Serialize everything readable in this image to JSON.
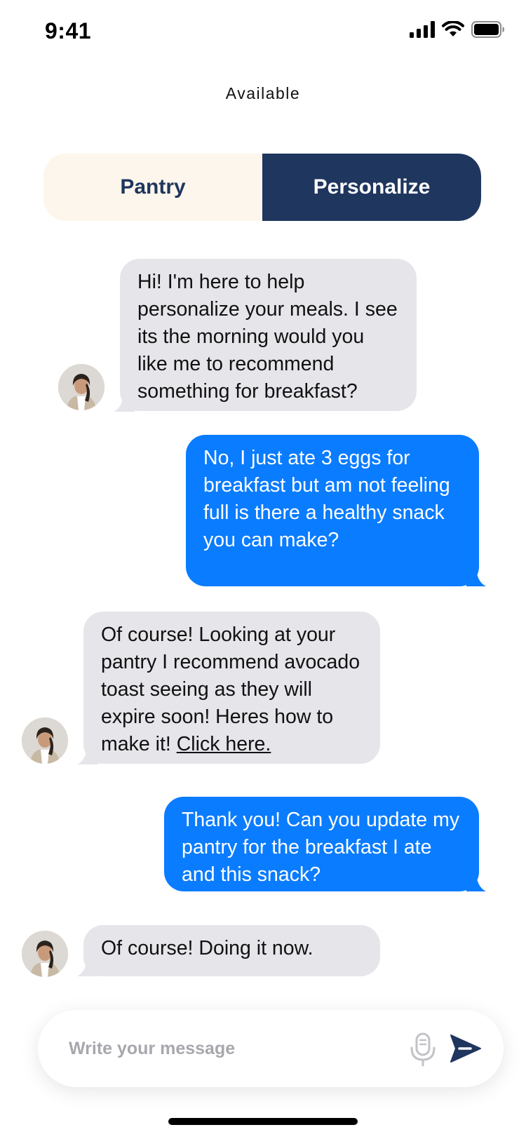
{
  "status_bar": {
    "time": "9:41"
  },
  "header": {
    "status": "Available"
  },
  "tabs": [
    {
      "label": "Pantry",
      "selected": false
    },
    {
      "label": "Personalize",
      "selected": true
    }
  ],
  "messages": [
    {
      "sender": "assistant",
      "text": "Hi! I'm here to help personalize your meals. I see its the morning would you like me to recommend something for breakfast?"
    },
    {
      "sender": "user",
      "text": "No, I just ate 3 eggs for breakfast but am not feeling full is there a healthy snack you can make?"
    },
    {
      "sender": "assistant",
      "text": "Of course! Looking at your pantry I recommend avocado toast seeing as they will expire soon! Heres how to make it! ",
      "link": "Click here."
    },
    {
      "sender": "user",
      "text": "Thank you! Can you update my pantry for the breakfast I ate and this snack?"
    },
    {
      "sender": "assistant",
      "text": "Of course! Doing it now."
    }
  ],
  "composer": {
    "placeholder": "Write your message",
    "value": ""
  },
  "colors": {
    "navy": "#1f365e",
    "cream": "#fdf6ec",
    "incoming_bubble": "#e5e5ea",
    "outgoing_bubble": "#0a7cff"
  },
  "icons": [
    "cellular-signal-icon",
    "wifi-icon",
    "battery-icon",
    "microphone-icon",
    "send-icon"
  ]
}
